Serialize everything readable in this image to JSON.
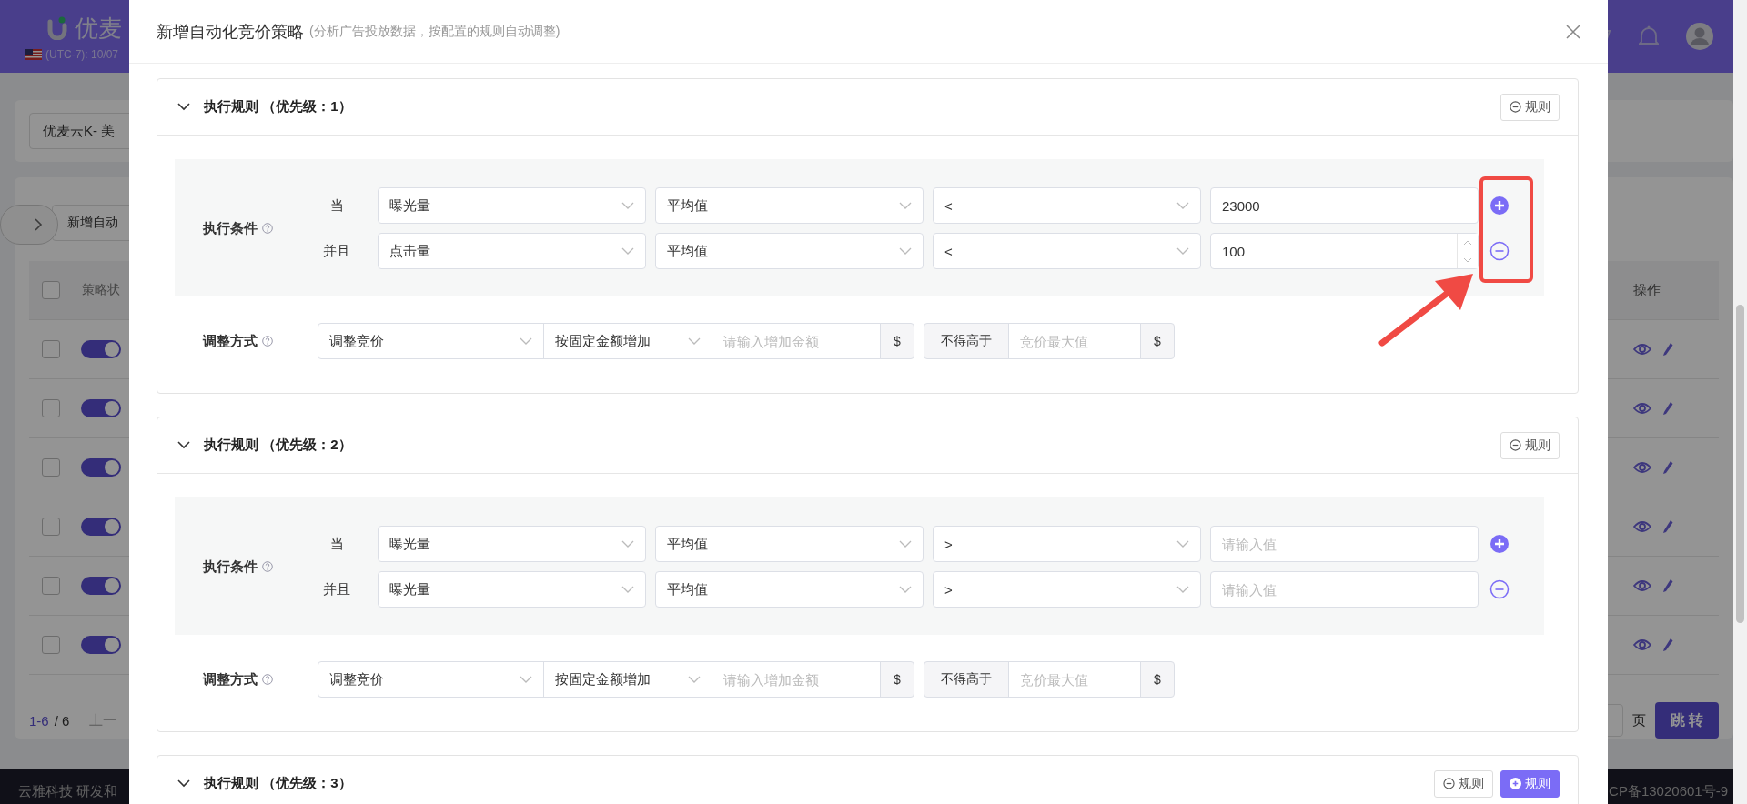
{
  "app": {
    "logo_text": "优麦",
    "timezone": "(UTC-7): 10/07",
    "store_select": "优麦云K- 美",
    "add_button": "新增自动",
    "columns": [
      "策略状",
      "操作"
    ],
    "header_checked": false,
    "rows": [
      {
        "selected": false,
        "enabled": true
      },
      {
        "selected": false,
        "enabled": true
      },
      {
        "selected": false,
        "enabled": true
      },
      {
        "selected": false,
        "enabled": true
      },
      {
        "selected": false,
        "enabled": true
      },
      {
        "selected": false,
        "enabled": true
      }
    ],
    "pagination": {
      "range": "1-6",
      "total": "/ 6",
      "prev": "上一",
      "page_suffix": "页",
      "jump": "跳 转"
    },
    "footer": {
      "left": "云雅科技 研发和",
      "right": "CP备13020601号-9"
    }
  },
  "modal": {
    "title": "新增自动化竞价策略",
    "subtitle": "(分析广告投放数据，按配置的规则自动调整)",
    "rules": [
      {
        "title": "执行规则 （优先级：1）",
        "highlight": true,
        "buttons": [
          {
            "kind": "remove",
            "label": "规则"
          }
        ],
        "condition_label": "执行条件",
        "conditions": [
          {
            "connector": "当",
            "metric": "曝光量",
            "aggregate": "平均值",
            "operator": "<",
            "value": "23000",
            "stepper": false,
            "kind": "add"
          },
          {
            "connector": "并且",
            "metric": "点击量",
            "aggregate": "平均值",
            "operator": "<",
            "value": "100",
            "stepper": true,
            "kind": "remove"
          }
        ],
        "adjust_label": "调整方式",
        "adjust": {
          "type": "调整竞价",
          "mode": "按固定金额增加",
          "amount_placeholder": "请输入增加金额",
          "amount_unit": "$",
          "limit_label": "不得高于",
          "limit_placeholder": "竞价最大值",
          "limit_unit": "$"
        }
      },
      {
        "title": "执行规则 （优先级：2）",
        "highlight": false,
        "buttons": [
          {
            "kind": "remove",
            "label": "规则"
          }
        ],
        "condition_label": "执行条件",
        "conditions": [
          {
            "connector": "当",
            "metric": "曝光量",
            "aggregate": "平均值",
            "operator": ">",
            "placeholder": "请输入值",
            "stepper": false,
            "kind": "add"
          },
          {
            "connector": "并且",
            "metric": "曝光量",
            "aggregate": "平均值",
            "operator": ">",
            "placeholder": "请输入值",
            "stepper": false,
            "kind": "remove"
          }
        ],
        "adjust_label": "调整方式",
        "adjust": {
          "type": "调整竞价",
          "mode": "按固定金额增加",
          "amount_placeholder": "请输入增加金额",
          "amount_unit": "$",
          "limit_label": "不得高于",
          "limit_placeholder": "竞价最大值",
          "limit_unit": "$"
        }
      },
      {
        "title": "执行规则 （优先级：3）",
        "buttons": [
          {
            "kind": "remove",
            "label": "规则"
          },
          {
            "kind": "add",
            "label": "规则"
          }
        ]
      }
    ]
  }
}
